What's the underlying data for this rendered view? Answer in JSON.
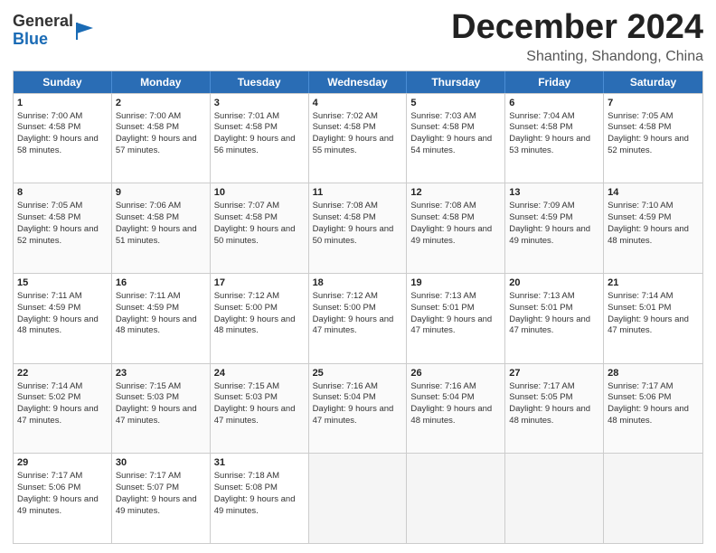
{
  "logo": {
    "general": "General",
    "blue": "Blue"
  },
  "title": "December 2024",
  "location": "Shanting, Shandong, China",
  "days_of_week": [
    "Sunday",
    "Monday",
    "Tuesday",
    "Wednesday",
    "Thursday",
    "Friday",
    "Saturday"
  ],
  "weeks": [
    [
      {
        "day": "1",
        "sunrise": "7:00 AM",
        "sunset": "4:58 PM",
        "daylight": "9 hours and 58 minutes."
      },
      {
        "day": "2",
        "sunrise": "7:00 AM",
        "sunset": "4:58 PM",
        "daylight": "9 hours and 57 minutes."
      },
      {
        "day": "3",
        "sunrise": "7:01 AM",
        "sunset": "4:58 PM",
        "daylight": "9 hours and 56 minutes."
      },
      {
        "day": "4",
        "sunrise": "7:02 AM",
        "sunset": "4:58 PM",
        "daylight": "9 hours and 55 minutes."
      },
      {
        "day": "5",
        "sunrise": "7:03 AM",
        "sunset": "4:58 PM",
        "daylight": "9 hours and 54 minutes."
      },
      {
        "day": "6",
        "sunrise": "7:04 AM",
        "sunset": "4:58 PM",
        "daylight": "9 hours and 53 minutes."
      },
      {
        "day": "7",
        "sunrise": "7:05 AM",
        "sunset": "4:58 PM",
        "daylight": "9 hours and 52 minutes."
      }
    ],
    [
      {
        "day": "8",
        "sunrise": "7:05 AM",
        "sunset": "4:58 PM",
        "daylight": "9 hours and 52 minutes."
      },
      {
        "day": "9",
        "sunrise": "7:06 AM",
        "sunset": "4:58 PM",
        "daylight": "9 hours and 51 minutes."
      },
      {
        "day": "10",
        "sunrise": "7:07 AM",
        "sunset": "4:58 PM",
        "daylight": "9 hours and 50 minutes."
      },
      {
        "day": "11",
        "sunrise": "7:08 AM",
        "sunset": "4:58 PM",
        "daylight": "9 hours and 50 minutes."
      },
      {
        "day": "12",
        "sunrise": "7:08 AM",
        "sunset": "4:58 PM",
        "daylight": "9 hours and 49 minutes."
      },
      {
        "day": "13",
        "sunrise": "7:09 AM",
        "sunset": "4:59 PM",
        "daylight": "9 hours and 49 minutes."
      },
      {
        "day": "14",
        "sunrise": "7:10 AM",
        "sunset": "4:59 PM",
        "daylight": "9 hours and 48 minutes."
      }
    ],
    [
      {
        "day": "15",
        "sunrise": "7:11 AM",
        "sunset": "4:59 PM",
        "daylight": "9 hours and 48 minutes."
      },
      {
        "day": "16",
        "sunrise": "7:11 AM",
        "sunset": "4:59 PM",
        "daylight": "9 hours and 48 minutes."
      },
      {
        "day": "17",
        "sunrise": "7:12 AM",
        "sunset": "5:00 PM",
        "daylight": "9 hours and 48 minutes."
      },
      {
        "day": "18",
        "sunrise": "7:12 AM",
        "sunset": "5:00 PM",
        "daylight": "9 hours and 47 minutes."
      },
      {
        "day": "19",
        "sunrise": "7:13 AM",
        "sunset": "5:01 PM",
        "daylight": "9 hours and 47 minutes."
      },
      {
        "day": "20",
        "sunrise": "7:13 AM",
        "sunset": "5:01 PM",
        "daylight": "9 hours and 47 minutes."
      },
      {
        "day": "21",
        "sunrise": "7:14 AM",
        "sunset": "5:01 PM",
        "daylight": "9 hours and 47 minutes."
      }
    ],
    [
      {
        "day": "22",
        "sunrise": "7:14 AM",
        "sunset": "5:02 PM",
        "daylight": "9 hours and 47 minutes."
      },
      {
        "day": "23",
        "sunrise": "7:15 AM",
        "sunset": "5:03 PM",
        "daylight": "9 hours and 47 minutes."
      },
      {
        "day": "24",
        "sunrise": "7:15 AM",
        "sunset": "5:03 PM",
        "daylight": "9 hours and 47 minutes."
      },
      {
        "day": "25",
        "sunrise": "7:16 AM",
        "sunset": "5:04 PM",
        "daylight": "9 hours and 47 minutes."
      },
      {
        "day": "26",
        "sunrise": "7:16 AM",
        "sunset": "5:04 PM",
        "daylight": "9 hours and 48 minutes."
      },
      {
        "day": "27",
        "sunrise": "7:17 AM",
        "sunset": "5:05 PM",
        "daylight": "9 hours and 48 minutes."
      },
      {
        "day": "28",
        "sunrise": "7:17 AM",
        "sunset": "5:06 PM",
        "daylight": "9 hours and 48 minutes."
      }
    ],
    [
      {
        "day": "29",
        "sunrise": "7:17 AM",
        "sunset": "5:06 PM",
        "daylight": "9 hours and 49 minutes."
      },
      {
        "day": "30",
        "sunrise": "7:17 AM",
        "sunset": "5:07 PM",
        "daylight": "9 hours and 49 minutes."
      },
      {
        "day": "31",
        "sunrise": "7:18 AM",
        "sunset": "5:08 PM",
        "daylight": "9 hours and 49 minutes."
      },
      null,
      null,
      null,
      null
    ]
  ],
  "week1_start_col": 0,
  "labels": {
    "sunrise": "Sunrise:",
    "sunset": "Sunset:",
    "daylight": "Daylight:"
  }
}
